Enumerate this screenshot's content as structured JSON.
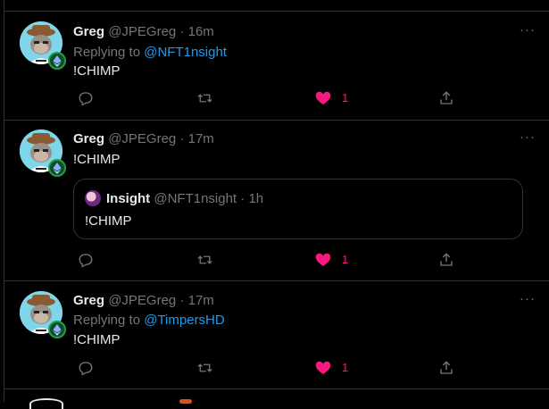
{
  "tweets": [
    {
      "name": "Greg",
      "handle": "@JPEGreg",
      "time": "16m",
      "replying_prefix": "Replying to ",
      "replying_to": "@NFT1nsight",
      "text": "!CHIMP",
      "likes": "1"
    },
    {
      "name": "Greg",
      "handle": "@JPEGreg",
      "time": "17m",
      "text": "!CHIMP",
      "likes": "1",
      "quote": {
        "name": "Insight",
        "handle": "@NFT1nsight",
        "time": "1h",
        "text": "!CHIMP"
      }
    },
    {
      "name": "Greg",
      "handle": "@JPEGreg",
      "time": "17m",
      "replying_prefix": "Replying to ",
      "replying_to": "@TimpersHD",
      "text": "!CHIMP",
      "likes": "1"
    }
  ],
  "ui": {
    "more_glyph": "···",
    "dot": " · "
  },
  "colors": {
    "background": "#000000",
    "link": "#1d9bf0",
    "like": "#f91880",
    "muted": "#71767b",
    "border": "#2f3336"
  },
  "icons": [
    "reply-icon",
    "retweet-icon",
    "like-icon",
    "share-icon",
    "more-icon",
    "ethereum-badge-icon"
  ]
}
